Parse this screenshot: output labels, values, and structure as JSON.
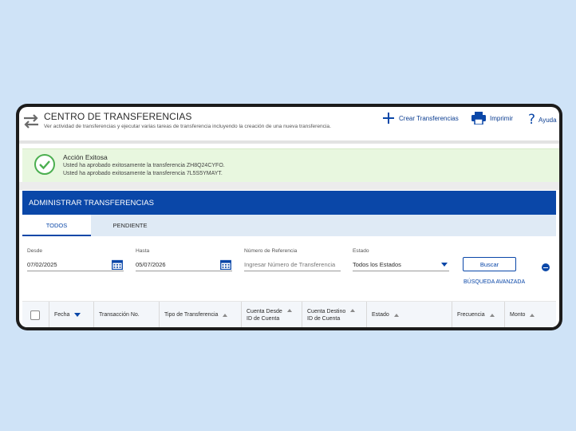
{
  "header": {
    "title": "CENTRO DE TRANSFERENCIAS",
    "subtitle": "Ver actividad de transferencias y ejecutar varias tareas de transferencia incluyendo la creación de una nueva transferencia.",
    "actions": {
      "create": "Crear Transferencias",
      "print": "Imprimir",
      "help": "Ayuda"
    }
  },
  "alert": {
    "title": "Acción Exitosa",
    "lines": [
      "Usted ha aprobado exitosamente la transferencia ZH8Q24CYFO.",
      "Usted ha aprobado exitosamente la transferencia 7L5S5YMAYT."
    ]
  },
  "section": {
    "title": "ADMINISTRAR TRANSFERENCIAS"
  },
  "tabs": [
    {
      "label": "TODOS",
      "active": true
    },
    {
      "label": "PENDIENTE",
      "active": false
    }
  ],
  "filters": {
    "desde": {
      "label": "Desde",
      "value": "07/02/2025"
    },
    "hasta": {
      "label": "Hasta",
      "value": "05/07/2026"
    },
    "referencia": {
      "label": "Número de Referencia",
      "placeholder": "Ingresar Número de Transferencia"
    },
    "estado": {
      "label": "Estado",
      "value": "Todos los Estados"
    },
    "search_button": "Buscar",
    "advanced_link": "BÚSQUEDA AVANZADA"
  },
  "table": {
    "columns": [
      {
        "label": "Fecha"
      },
      {
        "label": "Transacción No."
      },
      {
        "label": "Tipo de Transferencia"
      },
      {
        "label": "Cuenta Desde",
        "sub": "ID de Cuenta"
      },
      {
        "label": "Cuenta Destino",
        "sub": "ID de Cuenta"
      },
      {
        "label": "Estado"
      },
      {
        "label": "Frecuencia"
      },
      {
        "label": "Monto"
      }
    ]
  },
  "colors": {
    "primary": "#0a47a8",
    "success_bg": "#e8f7df",
    "success_icon": "#4caf50",
    "page_bg": "#cfe3f7"
  },
  "icons": {
    "header": "transfer-arrows-icon",
    "create": "plus-icon",
    "print": "printer-icon",
    "help": "question-mark-icon",
    "alert": "check-circle-icon",
    "date": "calendar-icon",
    "select": "chevron-down-icon",
    "collapse": "minus-circle-icon"
  }
}
